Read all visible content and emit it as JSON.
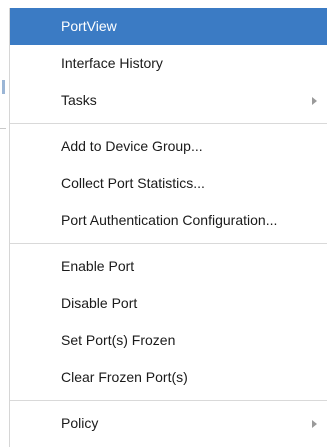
{
  "menu": {
    "groups": [
      [
        {
          "label": "PortView",
          "active": true,
          "submenu": false
        },
        {
          "label": "Interface History",
          "active": false,
          "submenu": false
        },
        {
          "label": "Tasks",
          "active": false,
          "submenu": true
        }
      ],
      [
        {
          "label": "Add to Device Group...",
          "active": false,
          "submenu": false
        },
        {
          "label": "Collect Port Statistics...",
          "active": false,
          "submenu": false
        },
        {
          "label": "Port Authentication Configuration...",
          "active": false,
          "submenu": false
        }
      ],
      [
        {
          "label": "Enable Port",
          "active": false,
          "submenu": false
        },
        {
          "label": "Disable Port",
          "active": false,
          "submenu": false
        },
        {
          "label": "Set Port(s) Frozen",
          "active": false,
          "submenu": false
        },
        {
          "label": "Clear Frozen Port(s)",
          "active": false,
          "submenu": false
        }
      ],
      [
        {
          "label": "Policy",
          "active": false,
          "submenu": true
        }
      ]
    ]
  },
  "colors": {
    "highlight": "#3b7bc4",
    "text": "#1a1a1a",
    "separator": "#d9d9d9",
    "submenu_arrow": "#9a9a9a"
  },
  "icons": {
    "submenu_arrow": "chevron-right-icon"
  }
}
